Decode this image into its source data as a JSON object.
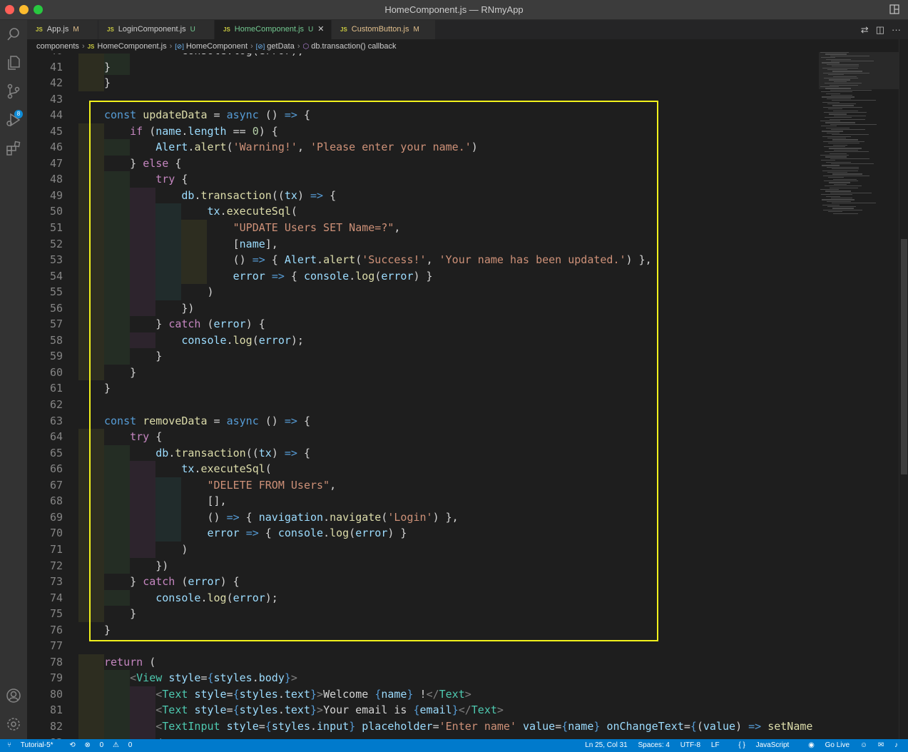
{
  "window": {
    "title": "HomeComponent.js — RNmyApp"
  },
  "tabs": [
    {
      "label": "App.js",
      "status": "M",
      "status_color": "#e2c08d",
      "active": false
    },
    {
      "label": "LoginComponent.js",
      "status": "U",
      "status_color": "#73c991",
      "active": false
    },
    {
      "label": "HomeComponent.js",
      "status": "U",
      "status_color": "#73c991",
      "active": true
    },
    {
      "label": "CustomButton.js",
      "status": "M",
      "status_color": "#e2c08d",
      "active": false
    }
  ],
  "breadcrumb": [
    "components",
    "HomeComponent.js",
    "HomeComponent",
    "getData",
    "db.transaction() callback"
  ],
  "scm_badge": "8",
  "status": {
    "branch": "Tutorial-5*",
    "errors": "0",
    "warnings": "0",
    "position": "Ln 25, Col 31",
    "spaces": "Spaces: 4",
    "encoding": "UTF-8",
    "eol": "LF",
    "language": "JavaScript",
    "golive": "Go Live"
  },
  "colors": {
    "accent": "#007acc",
    "highlight_box": "#f2f21c",
    "editor_bg": "#1e1e1e"
  },
  "code": [
    {
      "n": "40",
      "d": 2,
      "t": [
        [
          "            console.log(error);",
          ""
        ]
      ]
    },
    {
      "n": "41",
      "d": 2,
      "t": [
        [
          "}",
          ""
        ]
      ]
    },
    {
      "n": "42",
      "d": 1,
      "t": [
        [
          "}",
          ""
        ]
      ]
    },
    {
      "n": "43",
      "d": 0,
      "t": []
    },
    {
      "n": "44",
      "d": 0,
      "t": [
        [
          "const",
          "k"
        ],
        [
          " ",
          ""
        ],
        [
          "updateData",
          "f"
        ],
        [
          " = ",
          ""
        ],
        [
          "async",
          "k"
        ],
        [
          " () ",
          ""
        ],
        [
          "=>",
          "k"
        ],
        [
          " {",
          ""
        ]
      ]
    },
    {
      "n": "45",
      "d": 1,
      "t": [
        [
          "    ",
          ""
        ],
        [
          "if",
          "kc"
        ],
        [
          " (",
          ""
        ],
        [
          "name",
          "v"
        ],
        [
          ".",
          ""
        ],
        [
          "length",
          "v"
        ],
        [
          " == ",
          ""
        ],
        [
          "0",
          "n"
        ],
        [
          ") {",
          ""
        ]
      ]
    },
    {
      "n": "46",
      "d": 2,
      "t": [
        [
          "        ",
          ""
        ],
        [
          "Alert",
          "v"
        ],
        [
          ".",
          ""
        ],
        [
          "alert",
          "f"
        ],
        [
          "(",
          ""
        ],
        [
          "'Warning!'",
          "s"
        ],
        [
          ", ",
          ""
        ],
        [
          "'Please enter your name.'",
          "s"
        ],
        [
          ")",
          ""
        ]
      ]
    },
    {
      "n": "47",
      "d": 1,
      "t": [
        [
          "    } ",
          ""
        ],
        [
          "else",
          "kc"
        ],
        [
          " {",
          ""
        ]
      ]
    },
    {
      "n": "48",
      "d": 2,
      "t": [
        [
          "        ",
          ""
        ],
        [
          "try",
          "kc"
        ],
        [
          " {",
          ""
        ]
      ]
    },
    {
      "n": "49",
      "d": 3,
      "t": [
        [
          "            ",
          ""
        ],
        [
          "db",
          "v"
        ],
        [
          ".",
          ""
        ],
        [
          "transaction",
          "f"
        ],
        [
          "((",
          ""
        ],
        [
          "tx",
          "v"
        ],
        [
          ") ",
          ""
        ],
        [
          "=>",
          "k"
        ],
        [
          " {",
          ""
        ]
      ]
    },
    {
      "n": "50",
      "d": 4,
      "t": [
        [
          "                ",
          ""
        ],
        [
          "tx",
          "v"
        ],
        [
          ".",
          ""
        ],
        [
          "executeSql",
          "f"
        ],
        [
          "(",
          ""
        ]
      ]
    },
    {
      "n": "51",
      "d": 5,
      "t": [
        [
          "                    ",
          ""
        ],
        [
          "\"UPDATE Users SET Name=?\"",
          "s"
        ],
        [
          ",",
          ""
        ]
      ]
    },
    {
      "n": "52",
      "d": 5,
      "t": [
        [
          "                    [",
          ""
        ],
        [
          "name",
          "v"
        ],
        [
          "],",
          ""
        ]
      ]
    },
    {
      "n": "53",
      "d": 5,
      "t": [
        [
          "                    () ",
          ""
        ],
        [
          "=>",
          "k"
        ],
        [
          " { ",
          ""
        ],
        [
          "Alert",
          "v"
        ],
        [
          ".",
          ""
        ],
        [
          "alert",
          "f"
        ],
        [
          "(",
          ""
        ],
        [
          "'Success!'",
          "s"
        ],
        [
          ", ",
          ""
        ],
        [
          "'Your name has been updated.'",
          "s"
        ],
        [
          ") },",
          ""
        ]
      ]
    },
    {
      "n": "54",
      "d": 5,
      "t": [
        [
          "                    ",
          ""
        ],
        [
          "error",
          "v"
        ],
        [
          " ",
          ""
        ],
        [
          "=>",
          "k"
        ],
        [
          " { ",
          ""
        ],
        [
          "console",
          "v"
        ],
        [
          ".",
          ""
        ],
        [
          "log",
          "f"
        ],
        [
          "(",
          ""
        ],
        [
          "error",
          "v"
        ],
        [
          ") }",
          ""
        ]
      ]
    },
    {
      "n": "55",
      "d": 4,
      "t": [
        [
          "                )",
          ""
        ]
      ]
    },
    {
      "n": "56",
      "d": 3,
      "t": [
        [
          "            })",
          ""
        ]
      ]
    },
    {
      "n": "57",
      "d": 2,
      "t": [
        [
          "        } ",
          ""
        ],
        [
          "catch",
          "kc"
        ],
        [
          " (",
          ""
        ],
        [
          "error",
          "v"
        ],
        [
          ") {",
          ""
        ]
      ]
    },
    {
      "n": "58",
      "d": 3,
      "t": [
        [
          "            ",
          ""
        ],
        [
          "console",
          "v"
        ],
        [
          ".",
          ""
        ],
        [
          "log",
          "f"
        ],
        [
          "(",
          ""
        ],
        [
          "error",
          "v"
        ],
        [
          ");",
          ""
        ]
      ]
    },
    {
      "n": "59",
      "d": 2,
      "t": [
        [
          "        }",
          ""
        ]
      ]
    },
    {
      "n": "60",
      "d": 1,
      "t": [
        [
          "    }",
          ""
        ]
      ]
    },
    {
      "n": "61",
      "d": 0,
      "t": [
        [
          "}",
          ""
        ]
      ]
    },
    {
      "n": "62",
      "d": 0,
      "t": []
    },
    {
      "n": "63",
      "d": 0,
      "t": [
        [
          "const",
          "k"
        ],
        [
          " ",
          ""
        ],
        [
          "removeData",
          "f"
        ],
        [
          " = ",
          ""
        ],
        [
          "async",
          "k"
        ],
        [
          " () ",
          ""
        ],
        [
          "=>",
          "k"
        ],
        [
          " {",
          ""
        ]
      ]
    },
    {
      "n": "64",
      "d": 1,
      "t": [
        [
          "    ",
          ""
        ],
        [
          "try",
          "kc"
        ],
        [
          " {",
          ""
        ]
      ]
    },
    {
      "n": "65",
      "d": 2,
      "t": [
        [
          "        ",
          ""
        ],
        [
          "db",
          "v"
        ],
        [
          ".",
          ""
        ],
        [
          "transaction",
          "f"
        ],
        [
          "((",
          ""
        ],
        [
          "tx",
          "v"
        ],
        [
          ") ",
          ""
        ],
        [
          "=>",
          "k"
        ],
        [
          " {",
          ""
        ]
      ]
    },
    {
      "n": "66",
      "d": 3,
      "t": [
        [
          "            ",
          ""
        ],
        [
          "tx",
          "v"
        ],
        [
          ".",
          ""
        ],
        [
          "executeSql",
          "f"
        ],
        [
          "(",
          ""
        ]
      ]
    },
    {
      "n": "67",
      "d": 4,
      "t": [
        [
          "                ",
          ""
        ],
        [
          "\"DELETE FROM Users\"",
          "s"
        ],
        [
          ",",
          ""
        ]
      ]
    },
    {
      "n": "68",
      "d": 4,
      "t": [
        [
          "                [],",
          ""
        ]
      ]
    },
    {
      "n": "69",
      "d": 4,
      "t": [
        [
          "                () ",
          ""
        ],
        [
          "=>",
          "k"
        ],
        [
          " { ",
          ""
        ],
        [
          "navigation",
          "v"
        ],
        [
          ".",
          ""
        ],
        [
          "navigate",
          "f"
        ],
        [
          "(",
          ""
        ],
        [
          "'Login'",
          "s"
        ],
        [
          ") },",
          ""
        ]
      ]
    },
    {
      "n": "70",
      "d": 4,
      "t": [
        [
          "                ",
          ""
        ],
        [
          "error",
          "v"
        ],
        [
          " ",
          ""
        ],
        [
          "=>",
          "k"
        ],
        [
          " { ",
          ""
        ],
        [
          "console",
          "v"
        ],
        [
          ".",
          ""
        ],
        [
          "log",
          "f"
        ],
        [
          "(",
          ""
        ],
        [
          "error",
          "v"
        ],
        [
          ") }",
          ""
        ]
      ]
    },
    {
      "n": "71",
      "d": 3,
      "t": [
        [
          "            )",
          ""
        ]
      ]
    },
    {
      "n": "72",
      "d": 2,
      "t": [
        [
          "        })",
          ""
        ]
      ]
    },
    {
      "n": "73",
      "d": 1,
      "t": [
        [
          "    } ",
          ""
        ],
        [
          "catch",
          "kc"
        ],
        [
          " (",
          ""
        ],
        [
          "error",
          "v"
        ],
        [
          ") {",
          ""
        ]
      ]
    },
    {
      "n": "74",
      "d": 2,
      "t": [
        [
          "        ",
          ""
        ],
        [
          "console",
          "v"
        ],
        [
          ".",
          ""
        ],
        [
          "log",
          "f"
        ],
        [
          "(",
          ""
        ],
        [
          "error",
          "v"
        ],
        [
          ");",
          ""
        ]
      ]
    },
    {
      "n": "75",
      "d": 1,
      "t": [
        [
          "    }",
          ""
        ]
      ]
    },
    {
      "n": "76",
      "d": 0,
      "t": [
        [
          "}",
          ""
        ]
      ]
    },
    {
      "n": "77",
      "d": 0,
      "t": []
    },
    {
      "n": "78",
      "d": 1,
      "t": [
        [
          "",
          ""
        ],
        [
          "return",
          "kc"
        ],
        [
          " (",
          ""
        ]
      ]
    },
    {
      "n": "79",
      "d": 2,
      "t": [
        [
          "    ",
          ""
        ],
        [
          "<",
          "tg"
        ],
        [
          "View",
          "c"
        ],
        [
          " ",
          ""
        ],
        [
          "style",
          "v"
        ],
        [
          "=",
          ""
        ],
        [
          "{",
          "k"
        ],
        [
          "styles",
          "v"
        ],
        [
          ".",
          ""
        ],
        [
          "body",
          "v"
        ],
        [
          "}",
          "k"
        ],
        [
          ">",
          "tg"
        ]
      ]
    },
    {
      "n": "80",
      "d": 3,
      "t": [
        [
          "        ",
          ""
        ],
        [
          "<",
          "tg"
        ],
        [
          "Text",
          "c"
        ],
        [
          " ",
          ""
        ],
        [
          "style",
          "v"
        ],
        [
          "=",
          ""
        ],
        [
          "{",
          "k"
        ],
        [
          "styles",
          "v"
        ],
        [
          ".",
          ""
        ],
        [
          "text",
          "v"
        ],
        [
          "}",
          "k"
        ],
        [
          ">",
          "tg"
        ],
        [
          "Welcome ",
          ""
        ],
        [
          "{",
          "k"
        ],
        [
          "name",
          "v"
        ],
        [
          "}",
          "k"
        ],
        [
          " !",
          ""
        ],
        [
          "</",
          "tg"
        ],
        [
          "Text",
          "c"
        ],
        [
          ">",
          "tg"
        ]
      ]
    },
    {
      "n": "81",
      "d": 3,
      "t": [
        [
          "        ",
          ""
        ],
        [
          "<",
          "tg"
        ],
        [
          "Text",
          "c"
        ],
        [
          " ",
          ""
        ],
        [
          "style",
          "v"
        ],
        [
          "=",
          ""
        ],
        [
          "{",
          "k"
        ],
        [
          "styles",
          "v"
        ],
        [
          ".",
          ""
        ],
        [
          "text",
          "v"
        ],
        [
          "}",
          "k"
        ],
        [
          ">",
          "tg"
        ],
        [
          "Your email is ",
          ""
        ],
        [
          "{",
          "k"
        ],
        [
          "email",
          "v"
        ],
        [
          "}",
          "k"
        ],
        [
          "</",
          "tg"
        ],
        [
          "Text",
          "c"
        ],
        [
          ">",
          "tg"
        ]
      ]
    },
    {
      "n": "82",
      "d": 3,
      "t": [
        [
          "        ",
          ""
        ],
        [
          "<",
          "tg"
        ],
        [
          "TextInput",
          "c"
        ],
        [
          " ",
          ""
        ],
        [
          "style",
          "v"
        ],
        [
          "=",
          ""
        ],
        [
          "{",
          "k"
        ],
        [
          "styles",
          "v"
        ],
        [
          ".",
          ""
        ],
        [
          "input",
          "v"
        ],
        [
          "}",
          "k"
        ],
        [
          " ",
          ""
        ],
        [
          "placeholder",
          "v"
        ],
        [
          "=",
          ""
        ],
        [
          "'Enter name'",
          "s"
        ],
        [
          " ",
          ""
        ],
        [
          "value",
          "v"
        ],
        [
          "=",
          ""
        ],
        [
          "{",
          "k"
        ],
        [
          "name",
          "v"
        ],
        [
          "}",
          "k"
        ],
        [
          " ",
          ""
        ],
        [
          "onChangeText",
          "v"
        ],
        [
          "=",
          ""
        ],
        [
          "{",
          "k"
        ],
        [
          "(",
          ""
        ],
        [
          "value",
          "v"
        ],
        [
          ") ",
          ""
        ],
        [
          "=>",
          "k"
        ],
        [
          " ",
          ""
        ],
        [
          "setName",
          "f"
        ]
      ]
    },
    {
      "n": "83",
      "d": 3,
      "t": [
        [
          "        ",
          ""
        ],
        [
          "/>",
          "tg"
        ]
      ]
    }
  ]
}
